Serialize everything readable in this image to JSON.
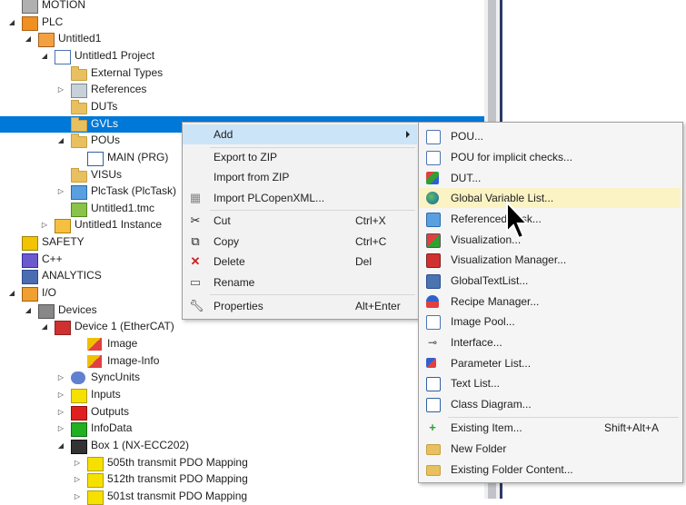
{
  "tree": {
    "rows": [
      {
        "label": "MOTION",
        "indent": 1,
        "expander": "",
        "icon": "motion-icon"
      },
      {
        "label": "PLC",
        "indent": 1,
        "expander": "◢",
        "icon": "plc-icon"
      },
      {
        "label": "Untitled1",
        "indent": 2,
        "expander": "◢",
        "icon": "plc-project-icon"
      },
      {
        "label": "Untitled1 Project",
        "indent": 3,
        "expander": "◢",
        "icon": "project-icon"
      },
      {
        "label": "External Types",
        "indent": 4,
        "expander": "",
        "icon": "folder-icon"
      },
      {
        "label": "References",
        "indent": 4,
        "expander": "▷",
        "icon": "references-icon"
      },
      {
        "label": "DUTs",
        "indent": 4,
        "expander": "",
        "icon": "folder-icon"
      },
      {
        "label": "GVLs",
        "indent": 4,
        "expander": "",
        "icon": "folder-icon",
        "selected": true
      },
      {
        "label": "POUs",
        "indent": 4,
        "expander": "◢",
        "icon": "folder-open-icon"
      },
      {
        "label": "MAIN (PRG)",
        "indent": 5,
        "expander": "",
        "icon": "program-icon"
      },
      {
        "label": "VISUs",
        "indent": 4,
        "expander": "",
        "icon": "folder-icon"
      },
      {
        "label": "PlcTask (PlcTask)",
        "indent": 4,
        "expander": "▷",
        "icon": "task-icon"
      },
      {
        "label": "Untitled1.tmc",
        "indent": 4,
        "expander": "",
        "icon": "tmc-icon"
      },
      {
        "label": "Untitled1 Instance",
        "indent": 3,
        "expander": "▷",
        "icon": "instance-icon"
      },
      {
        "label": "SAFETY",
        "indent": 1,
        "expander": "",
        "icon": "safety-icon"
      },
      {
        "label": "C++",
        "indent": 1,
        "expander": "",
        "icon": "cpp-icon"
      },
      {
        "label": "ANALYTICS",
        "indent": 1,
        "expander": "",
        "icon": "analytics-icon"
      },
      {
        "label": "I/O",
        "indent": 1,
        "expander": "◢",
        "icon": "io-icon"
      },
      {
        "label": "Devices",
        "indent": 2,
        "expander": "◢",
        "icon": "devices-icon"
      },
      {
        "label": "Device 1 (EtherCAT)",
        "indent": 3,
        "expander": "◢",
        "icon": "ethercat-icon"
      },
      {
        "label": "Image",
        "indent": 5,
        "expander": "",
        "icon": "image-icon"
      },
      {
        "label": "Image-Info",
        "indent": 5,
        "expander": "",
        "icon": "image-info-icon"
      },
      {
        "label": "SyncUnits",
        "indent": 4,
        "expander": "▷",
        "icon": "sync-units-icon"
      },
      {
        "label": "Inputs",
        "indent": 4,
        "expander": "▷",
        "icon": "inputs-icon"
      },
      {
        "label": "Outputs",
        "indent": 4,
        "expander": "▷",
        "icon": "outputs-icon"
      },
      {
        "label": "InfoData",
        "indent": 4,
        "expander": "▷",
        "icon": "infodata-icon"
      },
      {
        "label": "Box 1 (NX-ECC202)",
        "indent": 4,
        "expander": "◢",
        "icon": "box-icon"
      },
      {
        "label": "505th transmit PDO Mapping",
        "indent": 5,
        "expander": "▷",
        "icon": "pdo-icon"
      },
      {
        "label": "512th transmit PDO Mapping",
        "indent": 5,
        "expander": "▷",
        "icon": "pdo-icon"
      },
      {
        "label": "501st transmit PDO Mapping",
        "indent": 5,
        "expander": "▷",
        "icon": "pdo-icon"
      }
    ]
  },
  "context_menu": {
    "add": "Add",
    "export_zip": "Export to ZIP",
    "import_zip": "Import from ZIP",
    "import_plcopen": "Import PLCopenXML...",
    "cut": "Cut",
    "cut_key": "Ctrl+X",
    "copy": "Copy",
    "copy_key": "Ctrl+C",
    "delete": "Delete",
    "delete_key": "Del",
    "rename": "Rename",
    "properties": "Properties",
    "properties_key": "Alt+Enter"
  },
  "submenu": {
    "pou": "POU...",
    "pou_implicit": "POU for implicit checks...",
    "dut": "DUT...",
    "gvl": "Global Variable List...",
    "referenced_task": "Referenced Task...",
    "visualization": "Visualization...",
    "visualization_manager": "Visualization Manager...",
    "global_text_list": "GlobalTextList...",
    "recipe_manager": "Recipe Manager...",
    "image_pool": "Image Pool...",
    "interface": "Interface...",
    "parameter_list": "Parameter List...",
    "text_list": "Text List...",
    "class_diagram": "Class Diagram...",
    "existing_item": "Existing Item...",
    "existing_item_key": "Shift+Alt+A",
    "new_folder": "New Folder",
    "existing_folder": "Existing Folder Content..."
  },
  "colors": {
    "selection": "#0078d7",
    "menu_highlight": "#cce4f7",
    "submenu_highlight": "#fbf3c4"
  }
}
